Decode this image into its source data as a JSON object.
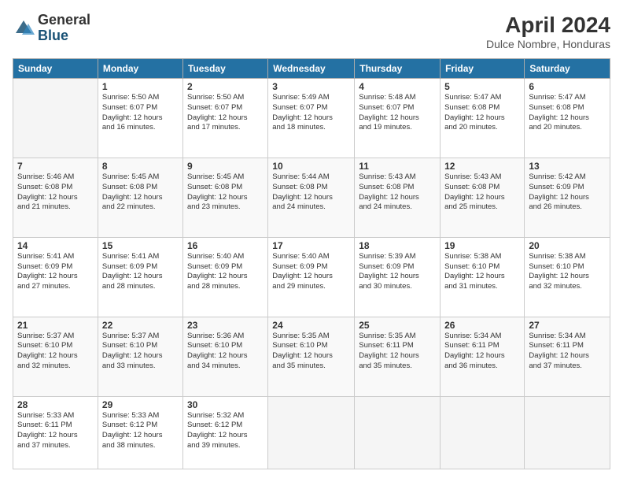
{
  "logo": {
    "general": "General",
    "blue": "Blue"
  },
  "header": {
    "month": "April 2024",
    "location": "Dulce Nombre, Honduras"
  },
  "weekdays": [
    "Sunday",
    "Monday",
    "Tuesday",
    "Wednesday",
    "Thursday",
    "Friday",
    "Saturday"
  ],
  "weeks": [
    [
      {
        "day": "",
        "info": ""
      },
      {
        "day": "1",
        "info": "Sunrise: 5:50 AM\nSunset: 6:07 PM\nDaylight: 12 hours\nand 16 minutes."
      },
      {
        "day": "2",
        "info": "Sunrise: 5:50 AM\nSunset: 6:07 PM\nDaylight: 12 hours\nand 17 minutes."
      },
      {
        "day": "3",
        "info": "Sunrise: 5:49 AM\nSunset: 6:07 PM\nDaylight: 12 hours\nand 18 minutes."
      },
      {
        "day": "4",
        "info": "Sunrise: 5:48 AM\nSunset: 6:07 PM\nDaylight: 12 hours\nand 19 minutes."
      },
      {
        "day": "5",
        "info": "Sunrise: 5:47 AM\nSunset: 6:08 PM\nDaylight: 12 hours\nand 20 minutes."
      },
      {
        "day": "6",
        "info": "Sunrise: 5:47 AM\nSunset: 6:08 PM\nDaylight: 12 hours\nand 20 minutes."
      }
    ],
    [
      {
        "day": "7",
        "info": "Sunrise: 5:46 AM\nSunset: 6:08 PM\nDaylight: 12 hours\nand 21 minutes."
      },
      {
        "day": "8",
        "info": "Sunrise: 5:45 AM\nSunset: 6:08 PM\nDaylight: 12 hours\nand 22 minutes."
      },
      {
        "day": "9",
        "info": "Sunrise: 5:45 AM\nSunset: 6:08 PM\nDaylight: 12 hours\nand 23 minutes."
      },
      {
        "day": "10",
        "info": "Sunrise: 5:44 AM\nSunset: 6:08 PM\nDaylight: 12 hours\nand 24 minutes."
      },
      {
        "day": "11",
        "info": "Sunrise: 5:43 AM\nSunset: 6:08 PM\nDaylight: 12 hours\nand 24 minutes."
      },
      {
        "day": "12",
        "info": "Sunrise: 5:43 AM\nSunset: 6:08 PM\nDaylight: 12 hours\nand 25 minutes."
      },
      {
        "day": "13",
        "info": "Sunrise: 5:42 AM\nSunset: 6:09 PM\nDaylight: 12 hours\nand 26 minutes."
      }
    ],
    [
      {
        "day": "14",
        "info": "Sunrise: 5:41 AM\nSunset: 6:09 PM\nDaylight: 12 hours\nand 27 minutes."
      },
      {
        "day": "15",
        "info": "Sunrise: 5:41 AM\nSunset: 6:09 PM\nDaylight: 12 hours\nand 28 minutes."
      },
      {
        "day": "16",
        "info": "Sunrise: 5:40 AM\nSunset: 6:09 PM\nDaylight: 12 hours\nand 28 minutes."
      },
      {
        "day": "17",
        "info": "Sunrise: 5:40 AM\nSunset: 6:09 PM\nDaylight: 12 hours\nand 29 minutes."
      },
      {
        "day": "18",
        "info": "Sunrise: 5:39 AM\nSunset: 6:09 PM\nDaylight: 12 hours\nand 30 minutes."
      },
      {
        "day": "19",
        "info": "Sunrise: 5:38 AM\nSunset: 6:10 PM\nDaylight: 12 hours\nand 31 minutes."
      },
      {
        "day": "20",
        "info": "Sunrise: 5:38 AM\nSunset: 6:10 PM\nDaylight: 12 hours\nand 32 minutes."
      }
    ],
    [
      {
        "day": "21",
        "info": "Sunrise: 5:37 AM\nSunset: 6:10 PM\nDaylight: 12 hours\nand 32 minutes."
      },
      {
        "day": "22",
        "info": "Sunrise: 5:37 AM\nSunset: 6:10 PM\nDaylight: 12 hours\nand 33 minutes."
      },
      {
        "day": "23",
        "info": "Sunrise: 5:36 AM\nSunset: 6:10 PM\nDaylight: 12 hours\nand 34 minutes."
      },
      {
        "day": "24",
        "info": "Sunrise: 5:35 AM\nSunset: 6:10 PM\nDaylight: 12 hours\nand 35 minutes."
      },
      {
        "day": "25",
        "info": "Sunrise: 5:35 AM\nSunset: 6:11 PM\nDaylight: 12 hours\nand 35 minutes."
      },
      {
        "day": "26",
        "info": "Sunrise: 5:34 AM\nSunset: 6:11 PM\nDaylight: 12 hours\nand 36 minutes."
      },
      {
        "day": "27",
        "info": "Sunrise: 5:34 AM\nSunset: 6:11 PM\nDaylight: 12 hours\nand 37 minutes."
      }
    ],
    [
      {
        "day": "28",
        "info": "Sunrise: 5:33 AM\nSunset: 6:11 PM\nDaylight: 12 hours\nand 37 minutes."
      },
      {
        "day": "29",
        "info": "Sunrise: 5:33 AM\nSunset: 6:12 PM\nDaylight: 12 hours\nand 38 minutes."
      },
      {
        "day": "30",
        "info": "Sunrise: 5:32 AM\nSunset: 6:12 PM\nDaylight: 12 hours\nand 39 minutes."
      },
      {
        "day": "",
        "info": ""
      },
      {
        "day": "",
        "info": ""
      },
      {
        "day": "",
        "info": ""
      },
      {
        "day": "",
        "info": ""
      }
    ]
  ]
}
